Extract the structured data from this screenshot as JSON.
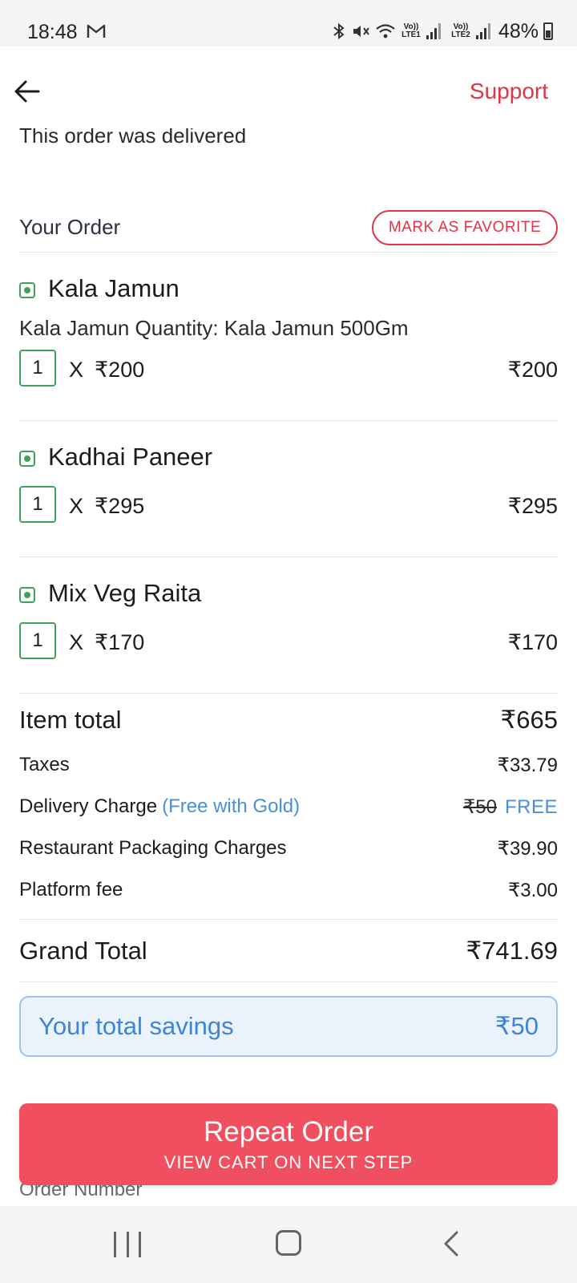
{
  "status_bar": {
    "time": "18:48",
    "lte1": "Vo)) LTE1",
    "lte2": "Vo)) LTE2",
    "battery": "48%"
  },
  "header": {
    "support_label": "Support",
    "delivered_text": "This order was delivered"
  },
  "order": {
    "title": "Your Order",
    "favorite_label": "MARK AS FAVORITE",
    "items": [
      {
        "name": "Kala Jamun",
        "description": "Kala Jamun Quantity: Kala Jamun 500Gm",
        "qty": "1",
        "times": "X",
        "unit_price": "₹200",
        "line_price": "₹200"
      },
      {
        "name": "Kadhai Paneer",
        "qty": "1",
        "times": "X",
        "unit_price": "₹295",
        "line_price": "₹295"
      },
      {
        "name": "Mix Veg Raita",
        "qty": "1",
        "times": "X",
        "unit_price": "₹170",
        "line_price": "₹170"
      }
    ]
  },
  "bill": {
    "item_total_label": "Item total",
    "item_total_value": "₹665",
    "taxes_label": "Taxes",
    "taxes_value": "₹33.79",
    "delivery_label": "Delivery Charge",
    "delivery_note": "(Free with Gold)",
    "delivery_original": "₹50",
    "delivery_value": "FREE",
    "packaging_label": "Restaurant Packaging Charges",
    "packaging_value": "₹39.90",
    "platform_label": "Platform fee",
    "platform_value": "₹3.00",
    "grand_total_label": "Grand Total",
    "grand_total_value": "₹741.69"
  },
  "savings": {
    "label": "Your total savings",
    "value": "₹50"
  },
  "actions": {
    "repeat_title": "Repeat Order",
    "repeat_subtitle": "VIEW CART ON NEXT STEP",
    "order_number_label": "Order Number"
  },
  "icons": {
    "back": "arrow-left-icon",
    "veg": "veg-indicator-icon"
  },
  "colors": {
    "accent": "#e03546",
    "button": "#ef4f5f",
    "veg": "#3ea35a",
    "link_blue": "#4a8fd9"
  }
}
